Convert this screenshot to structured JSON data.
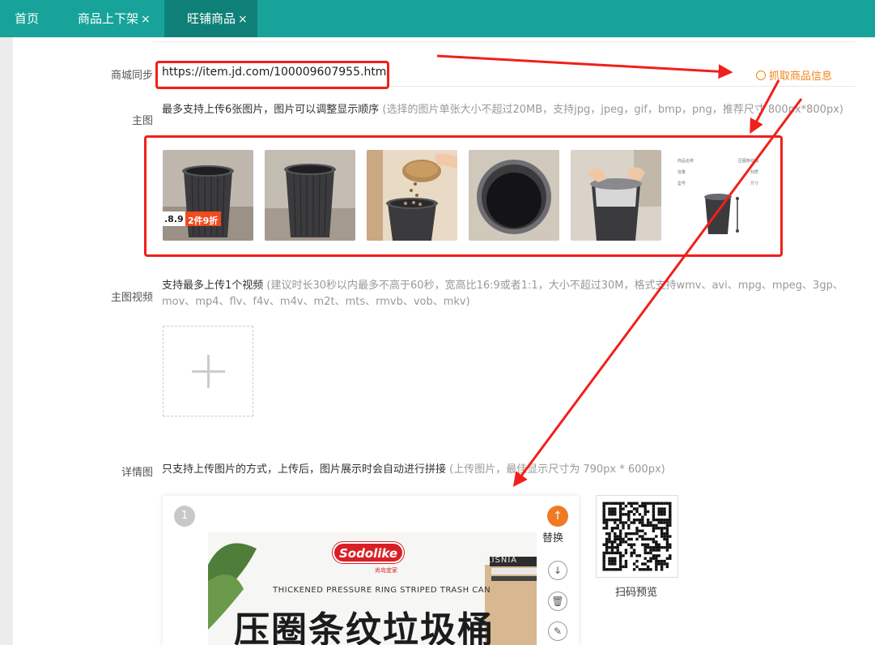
{
  "tabs": [
    {
      "label": "首页",
      "closable": false
    },
    {
      "label": "商品上下架",
      "closable": true
    },
    {
      "label": "旺铺商品",
      "closable": true,
      "active": true
    }
  ],
  "tab_close_glyph": "×",
  "form": {
    "sync_label": "商城同步",
    "sync_url": "https://item.jd.com/100009607955.html",
    "fetch_link": "抓取商品信息",
    "main_image": {
      "label": "主图",
      "hint": "最多支持上传6张图片，图片可以调整显示顺序",
      "hint_muted": "(选择的图片单张大小不超过20MB，支持jpg，jpeg，gif，bmp，png，推荐尺寸 800px*800px)",
      "badge_price": ".8.9",
      "badge_promo": "2件9折",
      "spec_lines": [
        "商品名称",
        "压圈条纹桶",
        "容量",
        "材质",
        "型号",
        "尺寸"
      ]
    },
    "main_video": {
      "label": "主图视频",
      "hint": "支持最多上传1个视频",
      "hint_muted": "(建议时长30秒以内最多不高于60秒，宽高比16:9或者1:1，大小不超过30M，格式支持wmv、avi、mpg、mpeg、3gp、mov、mp4、flv、f4v、m4v、m2t、mts、rmvb、vob、mkv)"
    },
    "detail": {
      "label": "详情图",
      "hint": "只支持上传图片的方式，上传后，图片展示时会自动进行拼接",
      "hint_muted": "(上传图片，最佳显示尺寸为 790px * 600px)",
      "index": "1",
      "replace_label": "替换",
      "brand": "Sodolike",
      "brand_sub": "尚岛宜家",
      "poster_en": "THICKENED PRESSURE RING STRIPED TRASH CAN",
      "poster_title": "压圈条纹垃圾桶",
      "poster_stack_text": "LISNIA",
      "qr_label": "扫码预览"
    }
  },
  "icons": {
    "fetch": "refresh-icon",
    "upload_plus": "plus-icon",
    "replace": "upload-arrow-icon",
    "move_down": "arrow-down-icon",
    "delete": "trash-icon",
    "edit": "edit-icon"
  },
  "colors": {
    "topbar": "#17a39a",
    "tab_active": "#0f8078",
    "annotation_red": "#f0201c",
    "link_orange": "#f08519",
    "bin_dark": "#3b3b3d"
  }
}
